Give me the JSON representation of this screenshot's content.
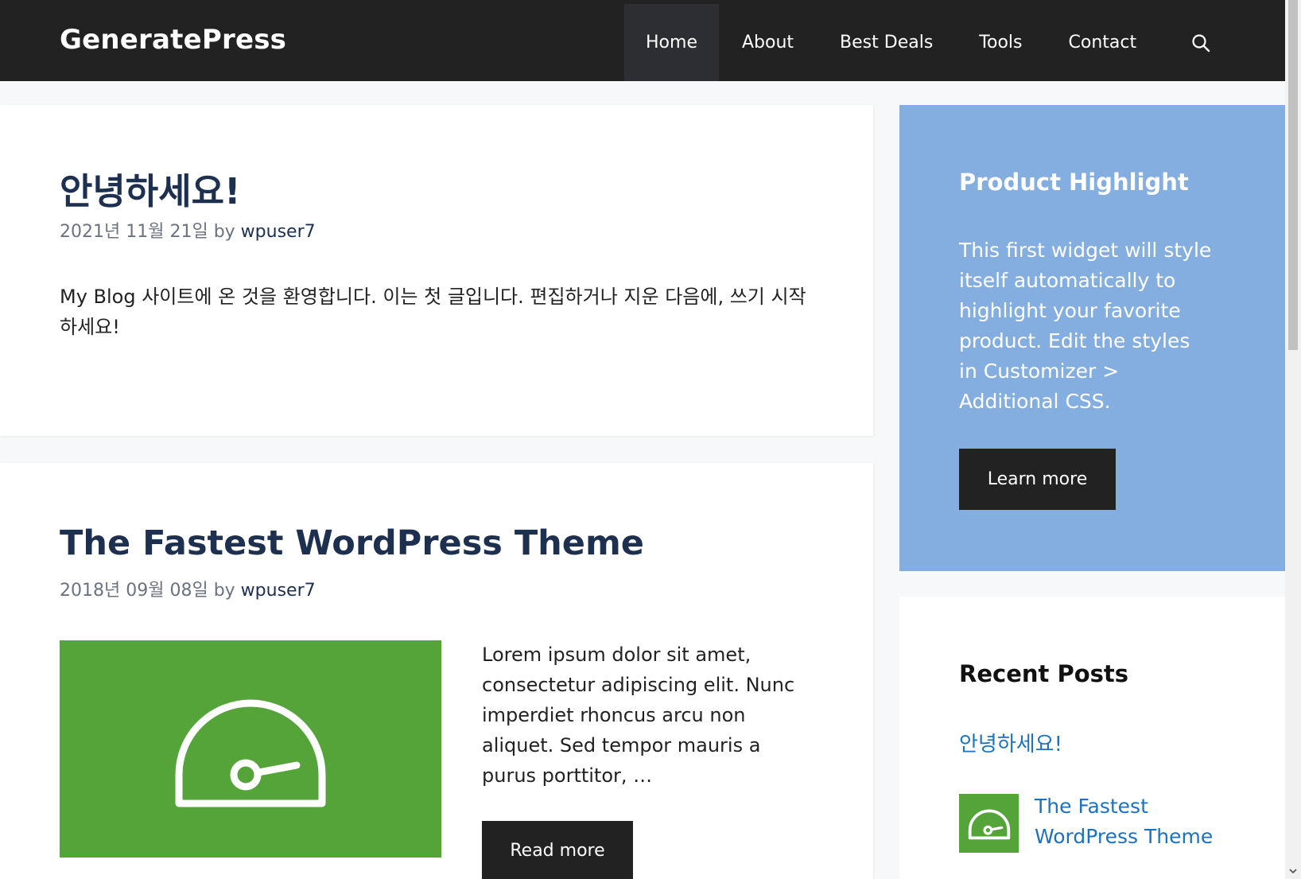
{
  "header": {
    "site_title": "GeneratePress",
    "nav": [
      "Home",
      "About",
      "Best Deals",
      "Tools",
      "Contact"
    ],
    "active_nav": "Home"
  },
  "posts": [
    {
      "title": "안녕하세요!",
      "date": "2021년 11월 21일",
      "by": "by",
      "author": "wpuser7",
      "content": "My Blog 사이트에 온 것을 환영합니다. 이는 첫 글입니다. 편집하거나 지운 다음에, 쓰기 시작하세요!"
    },
    {
      "title": "The Fastest WordPress Theme",
      "date": "2018년 09월 08일",
      "by": "by",
      "author": "wpuser7",
      "excerpt": "Lorem ipsum dolor sit amet, consectetur adipiscing elit. Nunc imperdiet rhoncus arcu non aliquet. Sed tempor mauris a purus porttitor, …",
      "read_more": "Read more",
      "image_icon": "speedometer-icon"
    }
  ],
  "sidebar": {
    "highlight": {
      "title": "Product Highlight",
      "text": "This first widget will style itself automatically to highlight your favorite product. Edit the styles in Customizer > Additional CSS.",
      "button": "Learn more"
    },
    "recent_posts": {
      "title": "Recent Posts",
      "items": [
        {
          "title": "안녕하세요!"
        },
        {
          "title": "The Fastest WordPress Theme",
          "thumb_icon": "speedometer-icon"
        }
      ]
    }
  },
  "colors": {
    "header_bg": "#222222",
    "title_color": "#1e3050",
    "link_color": "#1e72bd",
    "highlight_bg": "#84aedf",
    "image_green": "#55a43a"
  }
}
